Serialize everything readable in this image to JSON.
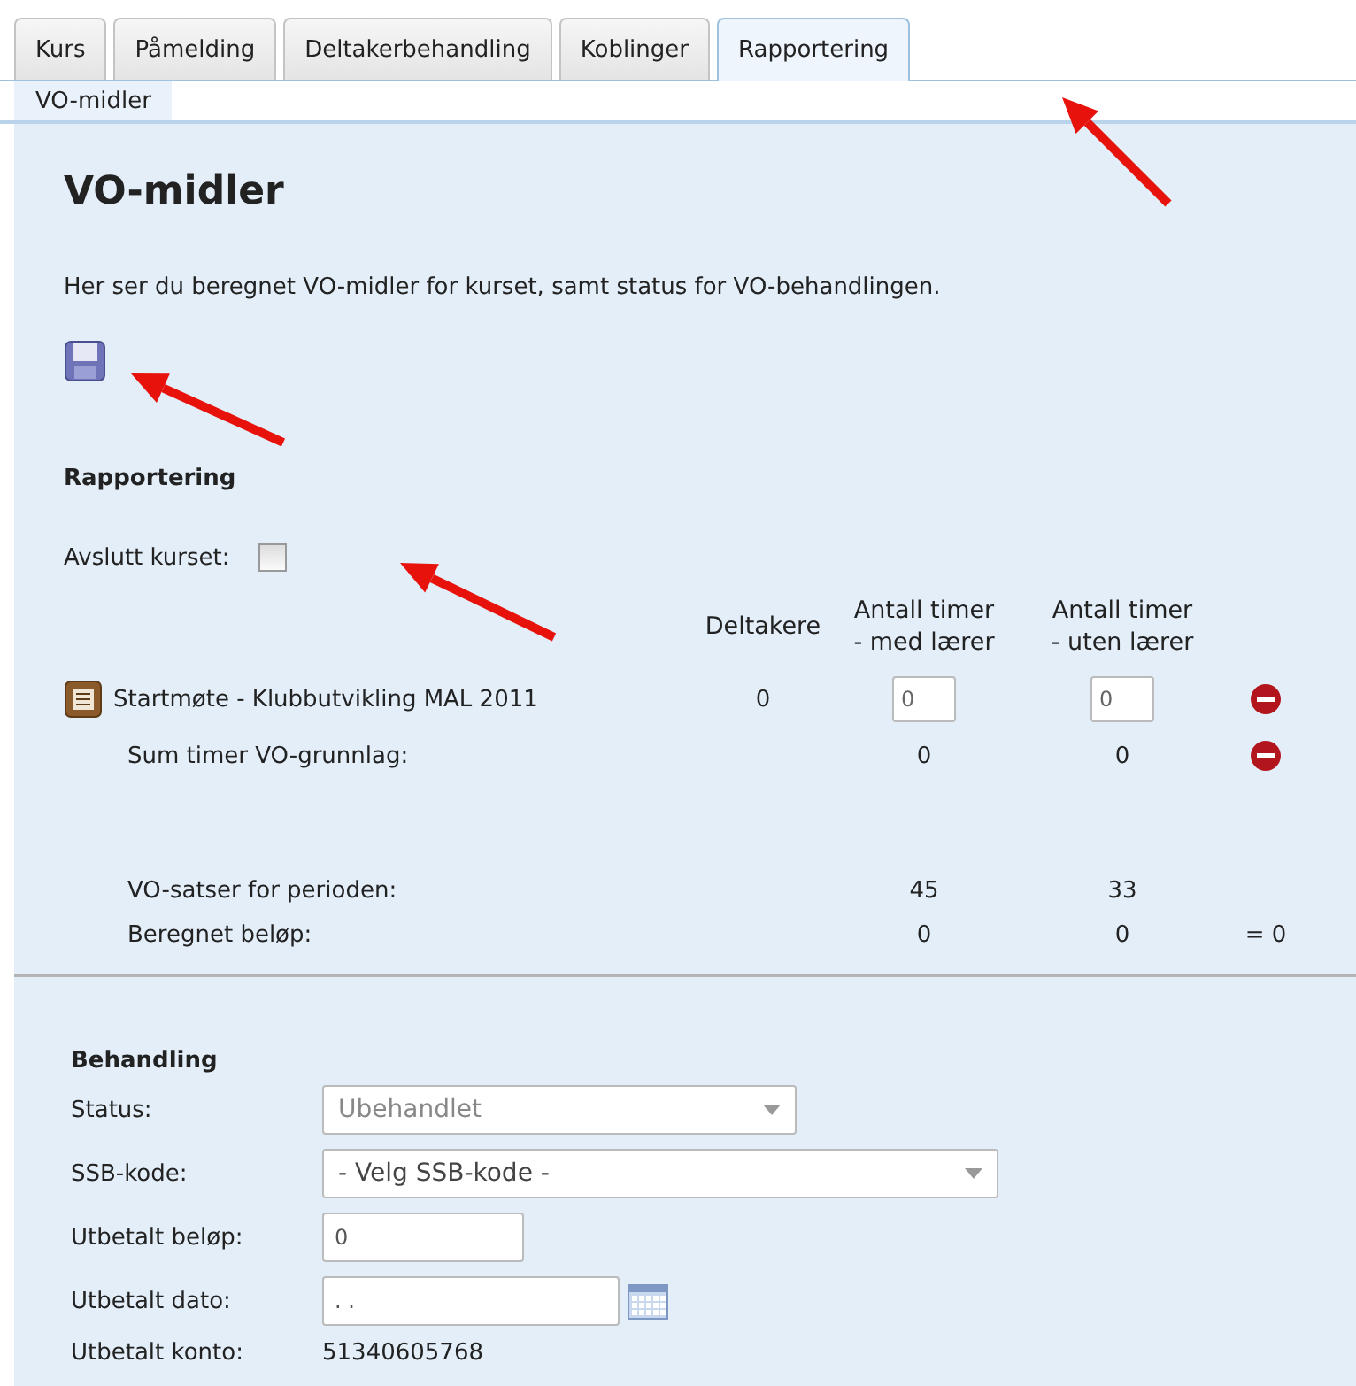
{
  "tabs": [
    {
      "label": "Kurs",
      "selected": false
    },
    {
      "label": "Påmelding",
      "selected": false
    },
    {
      "label": "Deltakerbehandling",
      "selected": false
    },
    {
      "label": "Koblinger",
      "selected": false
    },
    {
      "label": "Rapportering",
      "selected": true
    }
  ],
  "subtabs": [
    {
      "label": "VO-midler",
      "selected": true
    }
  ],
  "title": "VO-midler",
  "description": "Her ser du beregnet VO-midler for kurset, samt status for VO-behandlingen.",
  "reporting": {
    "heading": "Rapportering",
    "close_label": "Avslutt kurset:",
    "close_checked": false,
    "columns": [
      "Deltakere",
      "Antall timer\n- med lærer",
      "Antall timer\n- uten lærer"
    ],
    "rows": [
      {
        "kind": "item",
        "label": "Startmøte - Klubbutvikling MAL 2011",
        "participants": "0",
        "with_teacher": "0",
        "without_teacher": "0"
      },
      {
        "kind": "sum",
        "label": "Sum timer VO-grunnlag:",
        "with_teacher": "0",
        "without_teacher": "0"
      }
    ],
    "rates": [
      {
        "label": "VO-satser for perioden:",
        "with_teacher": "45",
        "without_teacher": "33"
      },
      {
        "label": "Beregnet beløp:",
        "with_teacher": "0",
        "without_teacher": "0",
        "total": "= 0"
      }
    ]
  },
  "processing": {
    "heading": "Behandling",
    "fields": [
      {
        "kind": "select",
        "label": "Status:",
        "value": "Ubehandlet",
        "disabled": true
      },
      {
        "kind": "select",
        "label": "SSB-kode:",
        "value": "- Velg SSB-kode -",
        "disabled": false
      },
      {
        "kind": "input",
        "label": "Utbetalt beløp:",
        "value": "0"
      },
      {
        "kind": "date",
        "label": "Utbetalt dato:",
        "value": ". ."
      },
      {
        "kind": "text",
        "label": "Utbetalt konto:",
        "value": "51340605768"
      }
    ]
  }
}
